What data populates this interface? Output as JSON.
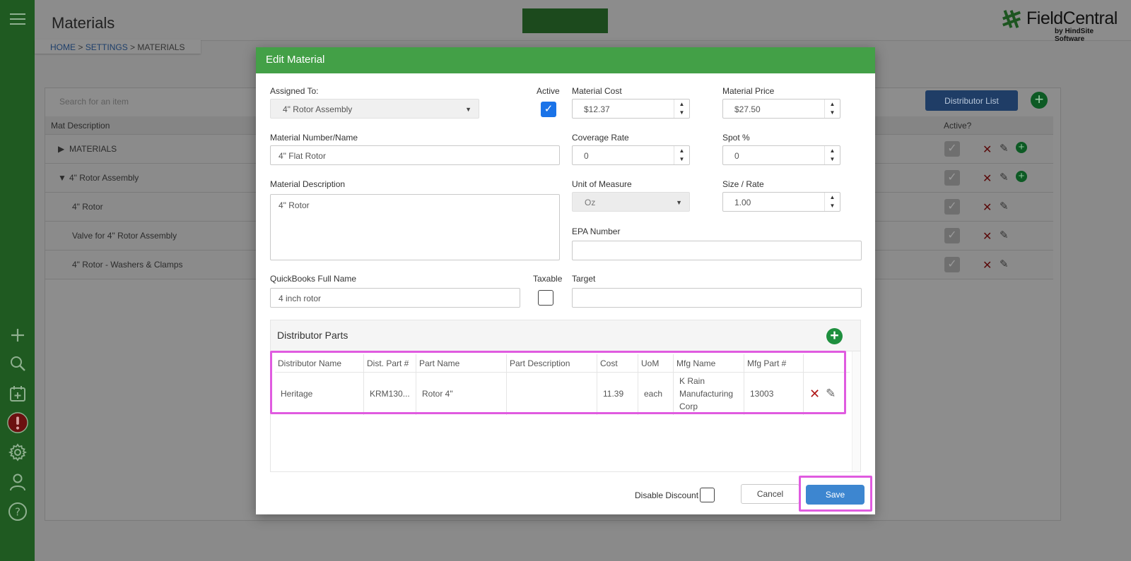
{
  "page": {
    "title": "Materials",
    "breadcrumb": {
      "home": "HOME",
      "sep1": " > ",
      "settings": "SETTINGS",
      "sep2": " > ",
      "current": "MATERIALS"
    },
    "logo": {
      "name": "FieldCentral",
      "sub": "by HindSite Software"
    }
  },
  "background_table": {
    "search_placeholder": "Search for an item",
    "distributor_list_button": "Distributor List",
    "col_desc": "Mat Description",
    "col_active": "Active?",
    "rows": [
      {
        "label": "MATERIALS",
        "toggle": "▶"
      },
      {
        "label": "4\" Rotor Assembly",
        "toggle": "▼"
      },
      {
        "label": "4\" Rotor",
        "toggle": ""
      },
      {
        "label": "Valve for 4\" Rotor Assembly",
        "toggle": ""
      },
      {
        "label": "4\" Rotor - Washers & Clamps",
        "toggle": ""
      }
    ]
  },
  "modal": {
    "title": "Edit Material",
    "assigned_to": {
      "label": "Assigned To:",
      "value": "4\" Rotor Assembly"
    },
    "active": {
      "label": "Active",
      "checked": true
    },
    "material_cost": {
      "label": "Material Cost",
      "value": "$12.37"
    },
    "material_price": {
      "label": "Material Price",
      "value": "$27.50"
    },
    "material_number": {
      "label": "Material Number/Name",
      "value": "4\" Flat Rotor"
    },
    "coverage_rate": {
      "label": "Coverage Rate",
      "value": "0"
    },
    "spot": {
      "label": "Spot %",
      "value": "0"
    },
    "material_description": {
      "label": "Material Description",
      "value": "4\" Rotor"
    },
    "unit_of_measure": {
      "label": "Unit of Measure",
      "value": "Oz"
    },
    "size_rate": {
      "label": "Size / Rate",
      "value": "1.00"
    },
    "epa_number": {
      "label": "EPA Number",
      "value": ""
    },
    "quickbooks_name": {
      "label": "QuickBooks Full Name",
      "value": "4 inch rotor"
    },
    "taxable": {
      "label": "Taxable",
      "checked": false
    },
    "target": {
      "label": "Target",
      "value": ""
    },
    "distributor_parts": {
      "title": "Distributor Parts",
      "columns": [
        "Distributor Name",
        "Dist. Part #",
        "Part Name",
        "Part Description",
        "Cost",
        "UoM",
        "Mfg Name",
        "Mfg Part #",
        ""
      ],
      "rows": [
        {
          "distributor_name": "Heritage",
          "dist_part": "KRM130...",
          "part_name": "Rotor 4\"",
          "part_description": "",
          "cost": "11.39",
          "uom": "each",
          "mfg_name": "K Rain Manufacturing Corp",
          "mfg_part": "13003"
        }
      ]
    },
    "disable_discount": {
      "label": "Disable Discount",
      "checked": false
    },
    "cancel_label": "Cancel",
    "save_label": "Save"
  },
  "colors": {
    "brand_green": "#43a047",
    "sidebar": "#1f5a21",
    "primary_blue": "#3d86d0",
    "highlight": "#e05be0"
  }
}
